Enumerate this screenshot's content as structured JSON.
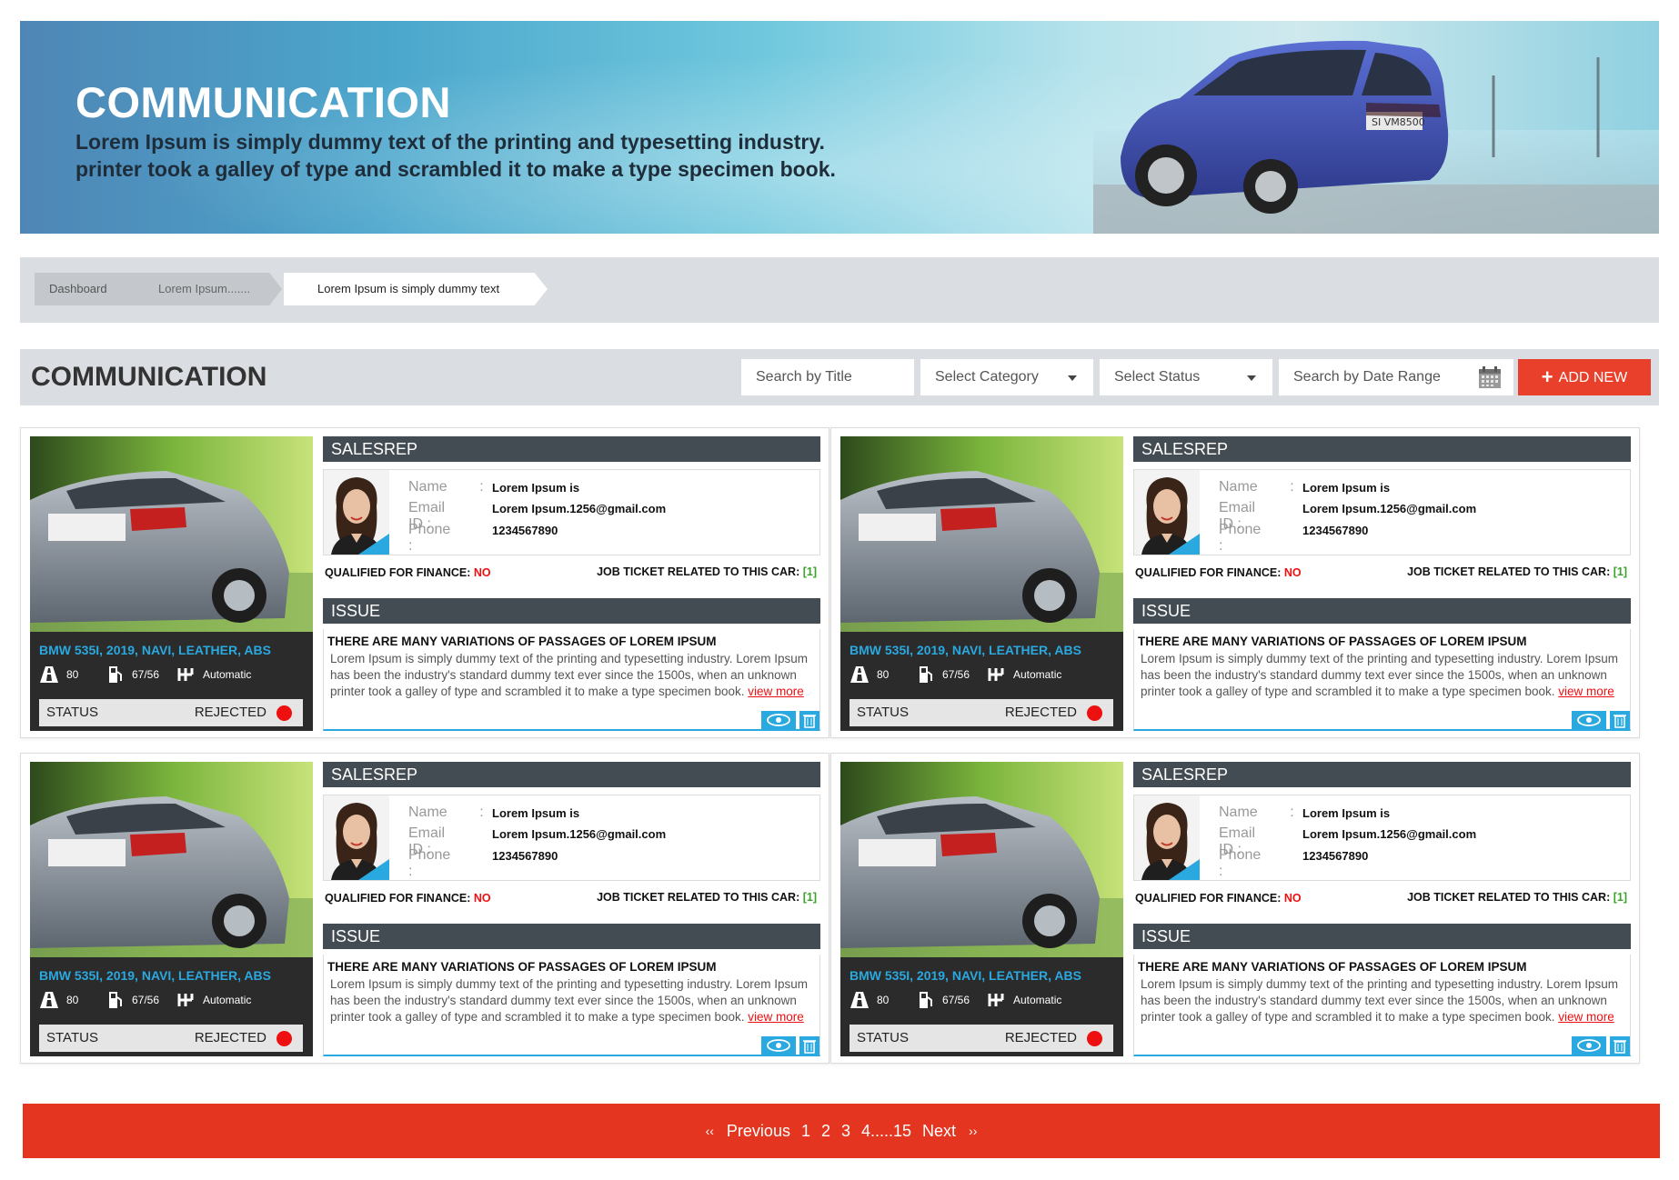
{
  "hero": {
    "title": "COMMUNICATION",
    "line1": "Lorem Ipsum is simply dummy text of the printing and typesetting industry.",
    "line2": "printer took a galley of type and scrambled it to make a type specimen book."
  },
  "breadcrumb": {
    "items": [
      "Dashboard",
      "Lorem Ipsum.......",
      "Lorem Ipsum is simply dummy text"
    ]
  },
  "section": {
    "title": "COMMUNICATION",
    "search_title": "Search by Title",
    "select_category": "Select Category",
    "select_status": "Select Status",
    "search_date": "Search by Date Range",
    "add_new": "ADD NEW"
  },
  "cards": [
    {
      "car_title": "BMW 535I, 2019, NAVI, LEATHER, ABS",
      "mileage": "80",
      "fuel": "67/56",
      "transmission": "Automatic",
      "status_label": "STATUS",
      "status_value": "REJECTED",
      "salesrep_header": "SALESREP",
      "name_label": "Name",
      "name_value": "Lorem Ipsum is",
      "email_label": "Email ID :",
      "email_value": "Lorem Ipsum.1256@gmail.com",
      "phone_label": "Phone :",
      "phone_value": "1234567890",
      "qualified_label": "QUALIFIED FOR FINANCE:",
      "qualified_value": "NO",
      "job_label": "JOB TICKET RELATED TO THIS CAR:",
      "job_value": "[1]",
      "issue_header": "ISSUE",
      "issue_title": "THERE ARE MANY VARIATIONS OF PASSAGES OF LOREM IPSUM",
      "issue_text": "Lorem Ipsum is simply dummy text of the printing and typesetting industry. Lorem Ipsum has been the industry's standard dummy text ever since the 1500s, when an unknown printer took a galley of type and scrambled it to make a type specimen book.",
      "view_more": "view more"
    },
    {
      "car_title": "BMW 535I, 2019, NAVI, LEATHER, ABS",
      "mileage": "80",
      "fuel": "67/56",
      "transmission": "Automatic",
      "status_label": "STATUS",
      "status_value": "REJECTED",
      "salesrep_header": "SALESREP",
      "name_label": "Name",
      "name_value": "Lorem Ipsum is",
      "email_label": "Email ID :",
      "email_value": "Lorem Ipsum.1256@gmail.com",
      "phone_label": "Phone :",
      "phone_value": "1234567890",
      "qualified_label": "QUALIFIED FOR FINANCE:",
      "qualified_value": "NO",
      "job_label": "JOB TICKET RELATED TO THIS CAR:",
      "job_value": "[1]",
      "issue_header": "ISSUE",
      "issue_title": "THERE ARE MANY VARIATIONS OF PASSAGES OF LOREM IPSUM",
      "issue_text": "Lorem Ipsum is simply dummy text of the printing and typesetting industry. Lorem Ipsum has been the industry's standard dummy text ever since the 1500s, when an unknown printer took a galley of type and scrambled it to make a type specimen book.",
      "view_more": "view more"
    },
    {
      "car_title": "BMW 535I, 2019, NAVI, LEATHER, ABS",
      "mileage": "80",
      "fuel": "67/56",
      "transmission": "Automatic",
      "status_label": "STATUS",
      "status_value": "REJECTED",
      "salesrep_header": "SALESREP",
      "name_label": "Name",
      "name_value": "Lorem Ipsum is",
      "email_label": "Email ID :",
      "email_value": "Lorem Ipsum.1256@gmail.com",
      "phone_label": "Phone :",
      "phone_value": "1234567890",
      "qualified_label": "QUALIFIED FOR FINANCE:",
      "qualified_value": "NO",
      "job_label": "JOB TICKET RELATED TO THIS CAR:",
      "job_value": "[1]",
      "issue_header": "ISSUE",
      "issue_title": "THERE ARE MANY VARIATIONS OF PASSAGES OF LOREM IPSUM",
      "issue_text": "Lorem Ipsum is simply dummy text of the printing and typesetting industry. Lorem Ipsum has been the industry's standard dummy text ever since the 1500s, when an unknown printer took a galley of type and scrambled it to make a type specimen book.",
      "view_more": "view more"
    },
    {
      "car_title": "BMW 535I, 2019, NAVI, LEATHER, ABS",
      "mileage": "80",
      "fuel": "67/56",
      "transmission": "Automatic",
      "status_label": "STATUS",
      "status_value": "REJECTED",
      "salesrep_header": "SALESREP",
      "name_label": "Name",
      "name_value": "Lorem Ipsum is",
      "email_label": "Email ID :",
      "email_value": "Lorem Ipsum.1256@gmail.com",
      "phone_label": "Phone :",
      "phone_value": "1234567890",
      "qualified_label": "QUALIFIED FOR FINANCE:",
      "qualified_value": "NO",
      "job_label": "JOB TICKET RELATED TO THIS CAR:",
      "job_value": "[1]",
      "issue_header": "ISSUE",
      "issue_title": "THERE ARE MANY VARIATIONS OF PASSAGES OF LOREM IPSUM",
      "issue_text": "Lorem Ipsum is simply dummy text of the printing and typesetting industry. Lorem Ipsum has been the industry's standard dummy text ever since the 1500s, when an unknown printer took a galley of type and scrambled it to make a type specimen book.",
      "view_more": "view more"
    }
  ],
  "pagination": {
    "prev_arrows": "‹‹",
    "previous": "Previous",
    "pages": [
      "1",
      "2",
      "3",
      "4.....15"
    ],
    "next": "Next",
    "next_arrows": "››"
  },
  "colors": {
    "accent_red": "#e3351f",
    "accent_blue": "#2aa8e0",
    "bar_dark": "#444c53",
    "status_red": "#ee1010",
    "ok_green": "#3aa32a"
  },
  "icons": [
    "calendar-icon",
    "plus-icon",
    "road-icon",
    "fuel-pump-icon",
    "gearbox-icon",
    "eye-icon",
    "trash-icon",
    "chevron-right-icon"
  ]
}
